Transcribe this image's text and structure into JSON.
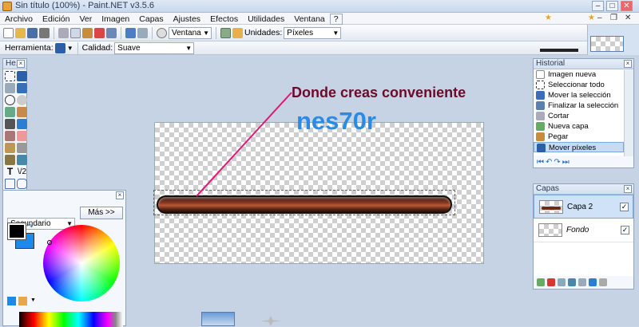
{
  "window": {
    "title": "Sin título (100%) - Paint.NET v3.5.6",
    "btn_min": "–",
    "btn_max": "□",
    "btn_close": "✕"
  },
  "menu": [
    "Archivo",
    "Edición",
    "Ver",
    "Imagen",
    "Capas",
    "Ajustes",
    "Efectos",
    "Utilidades",
    "Ventana",
    "?"
  ],
  "toolbar": {
    "zoom_value": "Ventana",
    "units_label": "Unidades:",
    "units_value": "Píxeles"
  },
  "toolbar2": {
    "tool_label": "Herramienta:",
    "quality_label": "Calidad:",
    "quality_value": "Suave"
  },
  "tools_panel": {
    "title": "He..."
  },
  "colors_panel": {
    "mode": "Secundario",
    "more_button": "Más >>",
    "primary": "#000000",
    "secondary": "#1b8ae8"
  },
  "canvas": {
    "annotation": "Donde creas conveniente",
    "watermark": "nes70r",
    "annotation_color": "#6b0a2a",
    "watermark_color": "#2a8be6",
    "line_color": "#e0187a"
  },
  "history": {
    "title": "Historial",
    "items": [
      "Imagen nueva",
      "Seleccionar todo",
      "Mover la selección",
      "Finalizar la selección",
      "Cortar",
      "Nueva capa",
      "Pegar",
      "Mover píxeles"
    ]
  },
  "layers": {
    "title": "Capas",
    "items": [
      {
        "name": "Capa 2",
        "checked": "✓"
      },
      {
        "name": "Fondo",
        "checked": "✓"
      }
    ]
  }
}
